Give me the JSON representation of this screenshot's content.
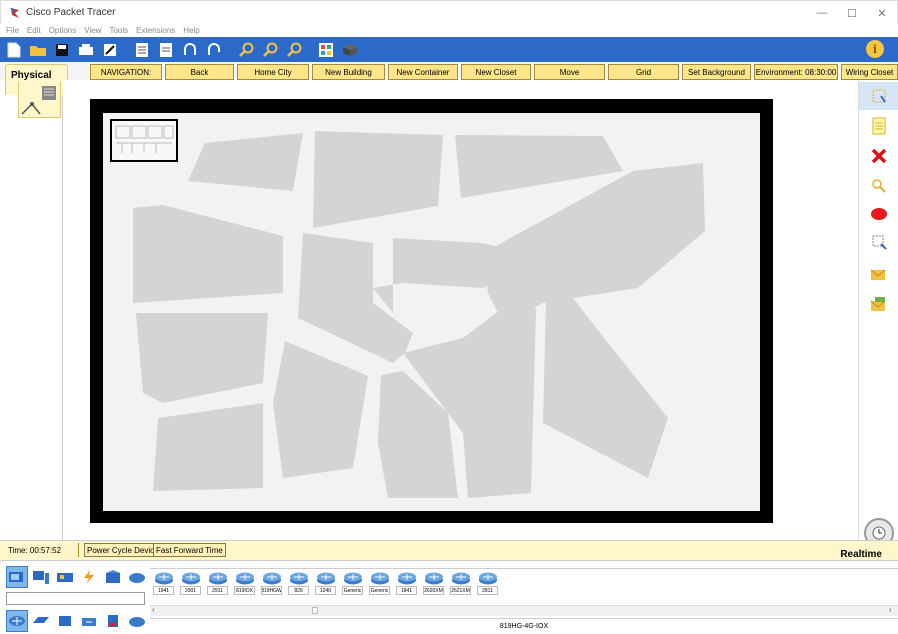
{
  "window": {
    "title": "Cisco Packet Tracer",
    "controls": {
      "minimize": "—",
      "maximize": "☐",
      "close": "✕"
    }
  },
  "menu": [
    "File",
    "Edit",
    "Options",
    "View",
    "Tools",
    "Extensions",
    "Help"
  ],
  "toolbar": {
    "icons": [
      "new-file-icon",
      "open-folder-icon",
      "save-icon",
      "print-icon",
      "activity-wizard-icon",
      "copy-icon",
      "paste-icon",
      "undo-icon",
      "redo-icon",
      "zoom-in-icon",
      "zoom-reset-icon",
      "zoom-out-icon",
      "palette-icon",
      "custom-device-icon"
    ],
    "info_label": "i"
  },
  "navigation": {
    "tab_label": "Physical",
    "buttons": [
      "NAVIGATION:",
      "Back",
      "Home City",
      "New Building",
      "New Container",
      "New Closet",
      "Move",
      "Grid",
      "Set Background",
      "Environment: 08:30:00",
      "Wiring Closet"
    ]
  },
  "right_tools": [
    "select-tool",
    "note-tool",
    "delete-tool",
    "inspect-tool",
    "draw-ellipse-tool",
    "resize-tool",
    "add-simple-pdu-tool",
    "add-complex-pdu-tool"
  ],
  "status": {
    "time": "Time: 00:57:52",
    "power_cycle": "Power Cycle Devices",
    "fast_forward": "Fast Forward Time",
    "mode": "Realtime"
  },
  "devices": {
    "categories_top": [
      "network-devices",
      "end-devices",
      "components",
      "connections",
      "misc",
      "multiuser"
    ],
    "categories_bottom": [
      "routers",
      "switches",
      "hubs",
      "wireless",
      "security",
      "wan-emulation"
    ],
    "models": [
      "1941",
      "2901",
      "2911",
      "819IOX",
      "819HGW",
      "829",
      "1240",
      "Generic",
      "Generic",
      "1841",
      "2620XM",
      "2621XM",
      "2811"
    ],
    "selected_model": "819HG-4G-IOX"
  },
  "colors": {
    "toolbar_bg": "#2b6ac9",
    "nav_button_bg": "#fde58a",
    "status_bg": "#fff6c9",
    "city_block": "#d4d4d4"
  }
}
